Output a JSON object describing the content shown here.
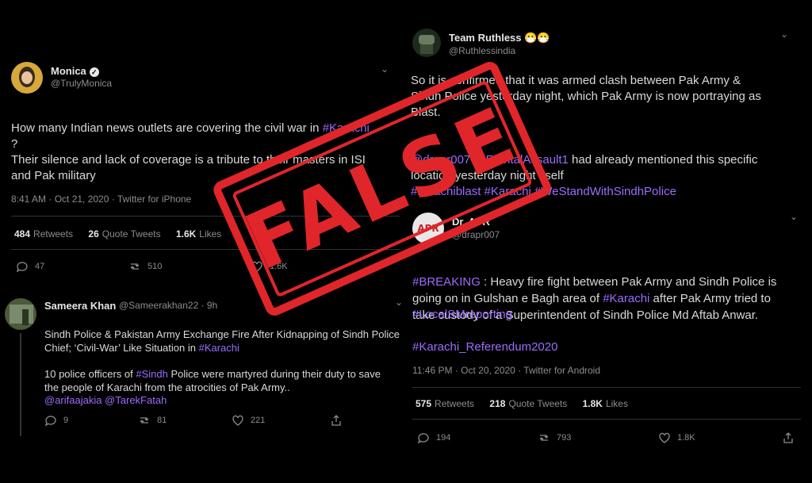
{
  "tweet1": {
    "name": "Monica",
    "handle": "@TrulyMonica",
    "line1_pre": "How many Indian news outlets are covering the civil war in ",
    "line1_tag": "#Karachi",
    "line1_post": "\n?",
    "line2": "Their silence and lack of coverage is a tribute to their masters in ISI\nand Pak military",
    "meta": "8:41 AM · Oct 21, 2020 · Twitter for iPhone",
    "retweets": "484",
    "retweets_label": "Retweets",
    "quotes": "26",
    "quotes_label": "Quote Tweets",
    "likes": "1.6K",
    "likes_label": "Likes",
    "reply_count": "47",
    "retweet_count": "510",
    "like_count": "1.6K"
  },
  "tweet2": {
    "name": "Sameera Khan",
    "handle": "@Sameerakhan22 · 9h",
    "headline_pre": "Sindh Police & Pakistan Army Exchange Fire After Kidnapping of Sindh Police\nChief; ‘Civil-War’ Like Situation in ",
    "headline_tag": "#Karachi",
    "body_pre": "10 police officers of ",
    "body_tag": "#Sindh",
    "body_post": " Police were martyred during their duty to save\nthe people of Karachi from the atrocities of Pak Army..",
    "mentions": "@arifaajakia @TarekFatah",
    "reply_count": "9",
    "retweet_count": "81",
    "like_count": "221"
  },
  "tweet3": {
    "name": "Team Ruthless",
    "name_emoji": "😷😷",
    "handle": "@Ruthlessindia",
    "line1": "So it is confirmed that it was armed clash between Pak Army &\nSindh Police yesterday night, which Pak Army is now portraying as\nBlast.",
    "mention_text": "@drapr007 @FrontalAssault1",
    "line2_post": " had already mentioned this specific\nlocation yesterday night itself",
    "tags": "#karachiblast #Karachi #WeStandWithSindhPolice"
  },
  "tweet4": {
    "name": "Dr. APR",
    "handle": "@drapr007",
    "avatar_text": "APR",
    "breaking_tag": "#BREAKING",
    "text_a": " : Heavy fire fight between Pak Army and Sindh Police is\ngoing on in Gulshan e Bagh area of ",
    "text_tag": "#Karachi",
    "text_b": " after Pak Army tried to\ntake custody of a Superintendent of Sindh Police Md Aftab Anwar.",
    "tag_line": "#LocalSMreporting",
    "tag_line2": "#Karachi_Referendum2020",
    "meta": "11:46 PM · Oct 20, 2020 · Twitter for Android",
    "retweets": "575",
    "retweets_label": "Retweets",
    "quotes": "218",
    "quotes_label": "Quote Tweets",
    "likes": "1.8K",
    "likes_label": "Likes",
    "reply_count": "194",
    "retweet_count": "793",
    "like_count": "1.8K"
  },
  "stamp": {
    "text": "FALSE",
    "color": "#e0262a"
  },
  "colors": {
    "hashtag": "#9b6cff",
    "background": "#000000",
    "muted": "#8a8d91"
  }
}
